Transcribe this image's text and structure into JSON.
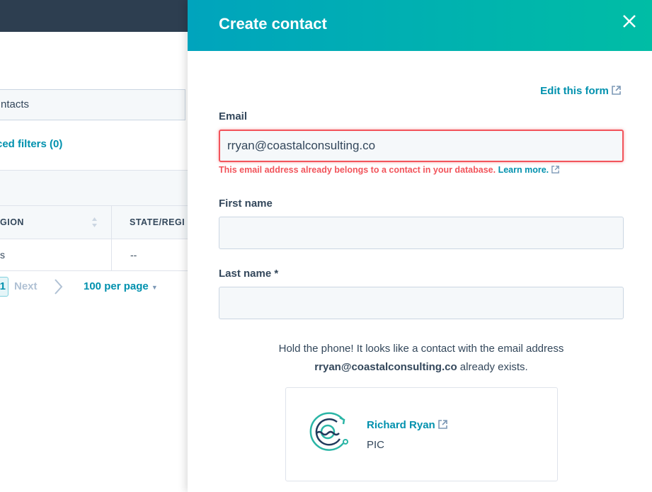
{
  "background": {
    "filter_text": "ntacts",
    "advanced_filters": "ced filters (0)",
    "columns": [
      "GION",
      "STATE/REGI"
    ],
    "row": [
      "s",
      "--"
    ],
    "pagination": {
      "current_page": "1",
      "next": "Next",
      "per_page": "100 per page"
    }
  },
  "panel": {
    "title": "Create contact",
    "edit_form_link": "Edit this form",
    "email": {
      "label": "Email",
      "value": "rryan@coastalconsulting.co"
    },
    "error": {
      "text": "This email address already belongs to a contact in your database.",
      "link": "Learn more."
    },
    "first_name": {
      "label": "First name",
      "value": ""
    },
    "last_name": {
      "label": "Last name *",
      "value": ""
    },
    "duplicate_message": {
      "line1": "Hold the phone! It looks like a contact with the email address",
      "email": "rryan@coastalconsulting.co",
      "suffix": " already exists."
    },
    "existing_contact": {
      "name": "Richard Ryan",
      "company": "PIC"
    }
  },
  "colors": {
    "accent": "#0091ae",
    "error": "#f2545b",
    "header_start": "#00a4bd",
    "header_end": "#00bda5",
    "topbar": "#2d3e50"
  }
}
